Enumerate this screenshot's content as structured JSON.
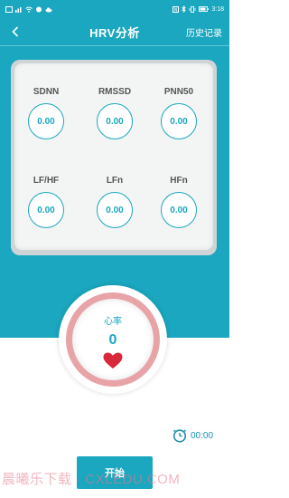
{
  "status_bar": {
    "left_icons": [
      "notification-icon",
      "sim-icon",
      "wifi-icon",
      "message-icon",
      "cloud-icon"
    ],
    "right_icons": [
      "nfc-icon",
      "bluetooth-icon",
      "vibrate-icon",
      "battery-icon"
    ],
    "time": "3:18"
  },
  "header": {
    "title": "HRV分析",
    "history_label": "历史记录"
  },
  "metrics": [
    {
      "label": "SDNN",
      "value": "0.00"
    },
    {
      "label": "RMSSD",
      "value": "0.00"
    },
    {
      "label": "PNN50",
      "value": "0.00"
    },
    {
      "label": "LF/HF",
      "value": "0.00"
    },
    {
      "label": "LFn",
      "value": "0.00"
    },
    {
      "label": "HFn",
      "value": "0.00"
    }
  ],
  "heart_rate": {
    "label": "心率",
    "value": "0"
  },
  "timer": {
    "value": "00:00"
  },
  "start_button": {
    "label": "开始"
  },
  "watermark": {
    "text": "晨曦乐下载 · CXLEDU.COM"
  },
  "colors": {
    "accent": "#1aa7bf",
    "heart_red": "#d9283a",
    "ring_pink": "#e8a3a7"
  }
}
